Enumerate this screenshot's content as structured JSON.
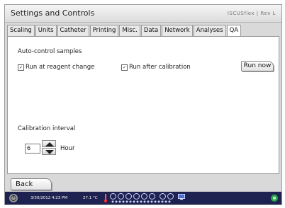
{
  "window": {
    "title": "Settings and Controls",
    "brand": "ISCUSflex | Rev L"
  },
  "tabs": [
    "Scaling",
    "Units",
    "Catheter",
    "Printing",
    "Misc.",
    "Data",
    "Network",
    "Analyses",
    "QA"
  ],
  "active_tab": "QA",
  "panel": {
    "section_label": "Auto-control samples",
    "checkbox_reagent": {
      "label": "Run at reagent change",
      "checked": true
    },
    "checkbox_calibration": {
      "label": "Run after calibration",
      "checked": true
    },
    "run_now_label": "Run now",
    "calibration_label": "Calibration interval",
    "interval_value": "6",
    "interval_unit": "Hour"
  },
  "footer": {
    "back_label": "Back"
  },
  "status": {
    "datetime": "3/30/2012 4:23 PM",
    "temperature": "27.1 °C"
  },
  "colors": {
    "status_bg": "#1e2250",
    "panel_bg": "#ffffff",
    "chrome_bg": "#d9d9d9"
  },
  "icons": [
    "power-icon",
    "thermometer-icon",
    "vial-indicator-icon",
    "monitor-icon",
    "network-icon"
  ]
}
